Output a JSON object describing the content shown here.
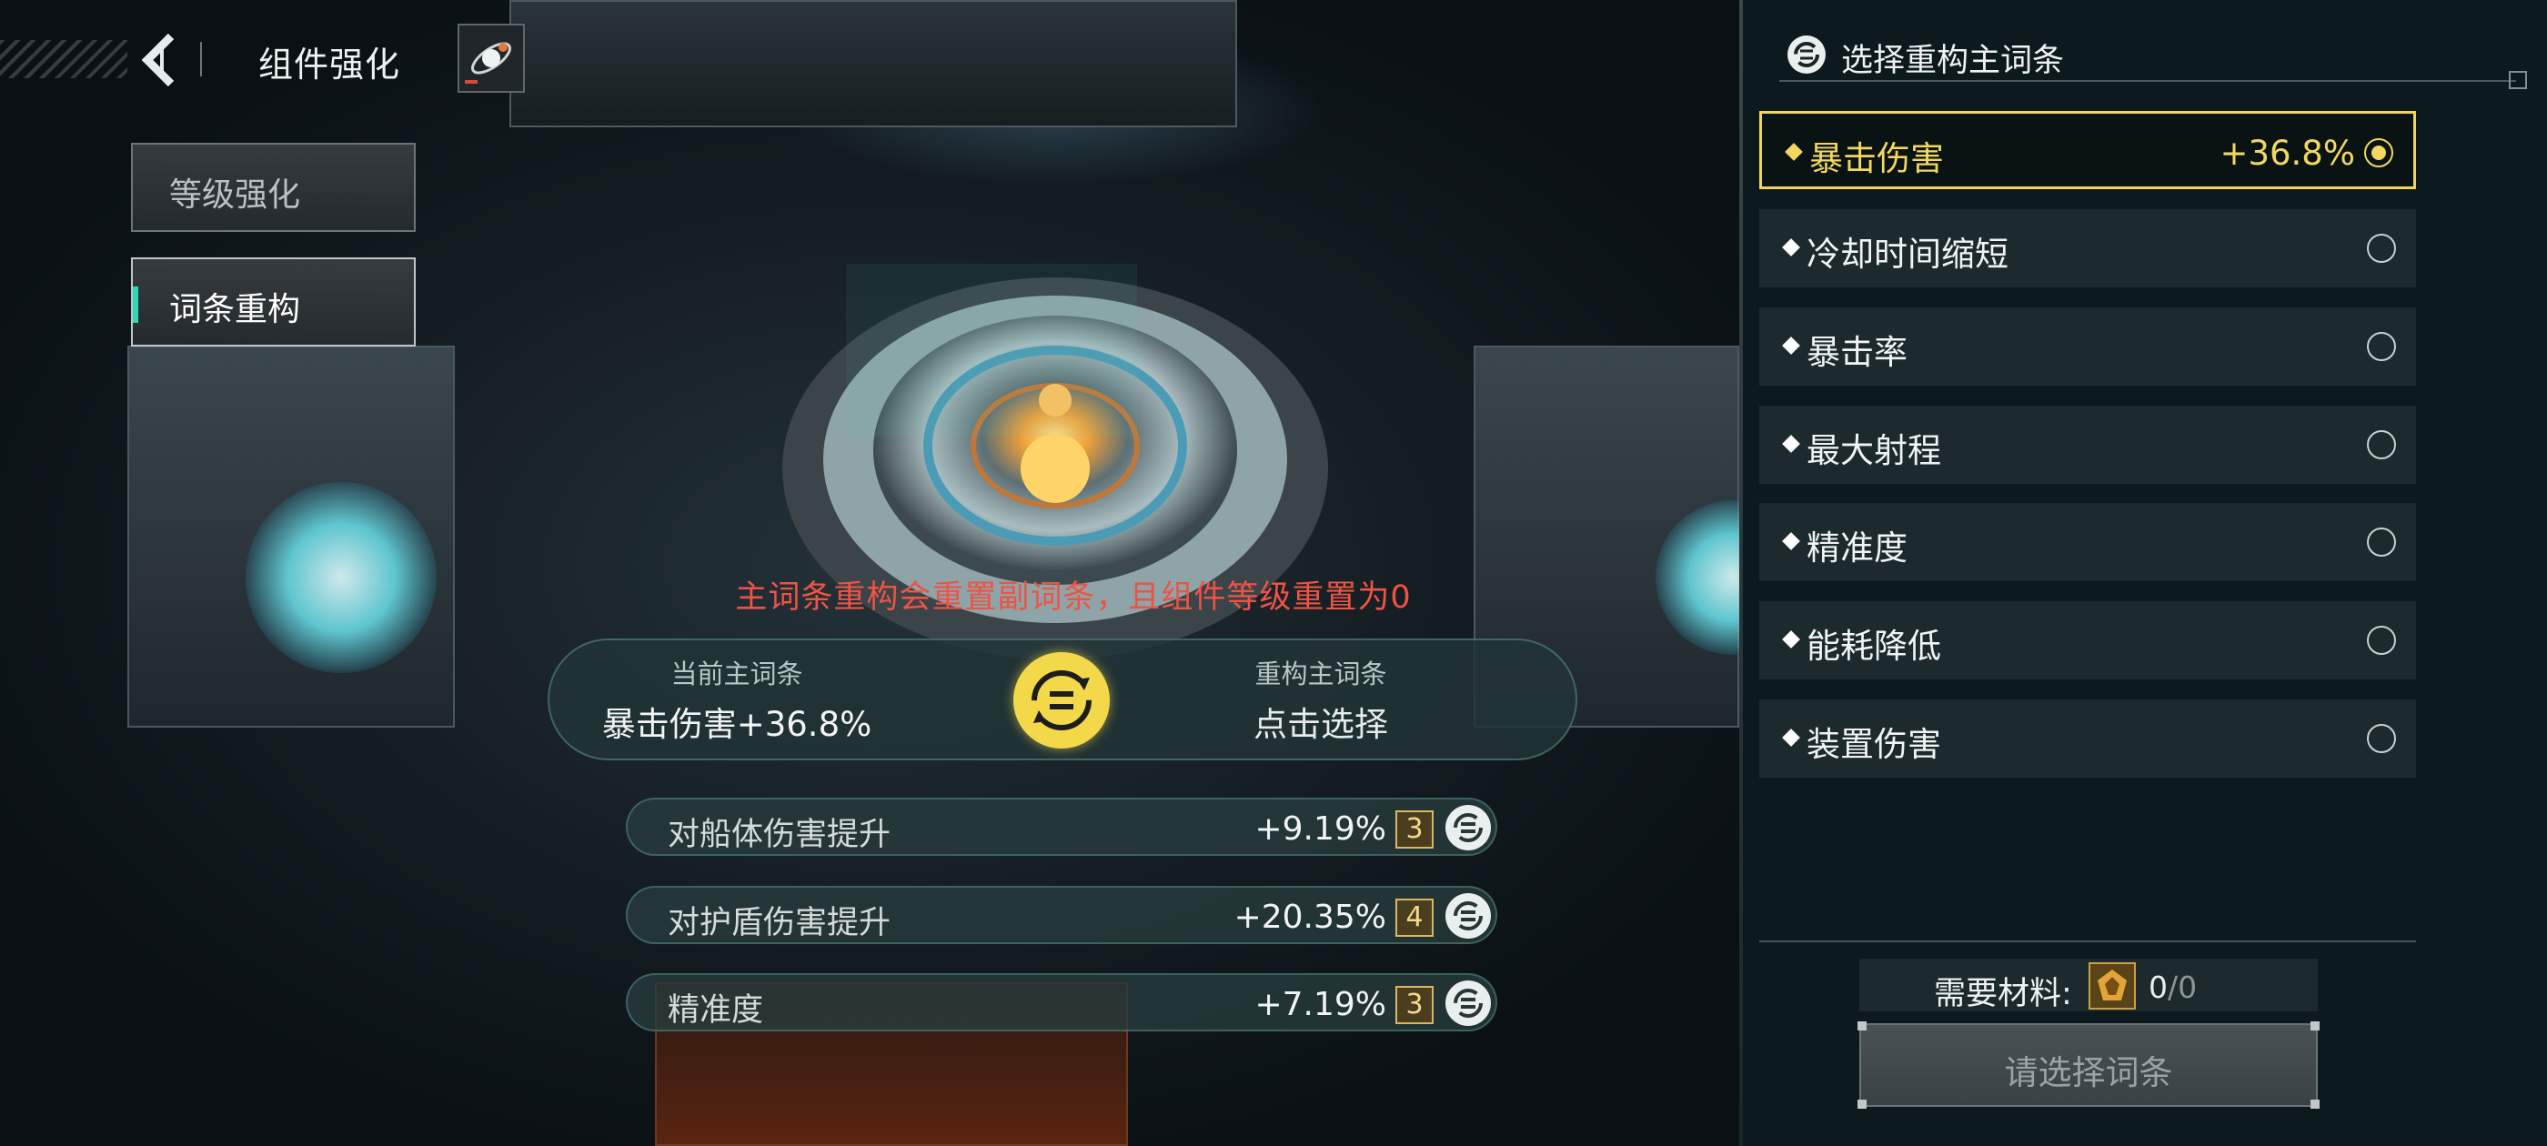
{
  "header": {
    "title": "组件强化"
  },
  "tabs": [
    {
      "label": "等级强化"
    },
    {
      "label": "词条重构"
    }
  ],
  "warning": "主词条重构会重置副词条，且组件等级重置为0",
  "compare": {
    "current_label": "当前主词条",
    "current_value": "暴击伤害+36.8%",
    "new_label": "重构主词条",
    "new_value": "点击选择"
  },
  "sub_attributes": [
    {
      "name": "对船体伤害提升",
      "value": "+9.19%",
      "level": "3"
    },
    {
      "name": "对护盾伤害提升",
      "value": "+20.35%",
      "level": "4"
    },
    {
      "name": "精准度",
      "value": "+7.19%",
      "level": "3"
    }
  ],
  "panel": {
    "title": "选择重构主词条",
    "options": [
      {
        "label": "暴击伤害",
        "value": "+36.8%",
        "selected": true
      },
      {
        "label": "冷却时间缩短",
        "value": "",
        "selected": false
      },
      {
        "label": "暴击率",
        "value": "",
        "selected": false
      },
      {
        "label": "最大射程",
        "value": "",
        "selected": false
      },
      {
        "label": "精准度",
        "value": "",
        "selected": false
      },
      {
        "label": "能耗降低",
        "value": "",
        "selected": false
      },
      {
        "label": "装置伤害",
        "value": "",
        "selected": false
      }
    ],
    "materials_label": "需要材料:",
    "materials_have": "0",
    "materials_need": "/0",
    "confirm_label": "请选择词条"
  },
  "colors": {
    "accent_yellow": "#f3d760",
    "warning_red": "#ef5343",
    "tab_marker": "#2fd9b6"
  },
  "icons": [
    "back-arrow-icon",
    "component-icon",
    "reforge-icon",
    "refresh-icon",
    "radio-icon",
    "material-icon"
  ]
}
